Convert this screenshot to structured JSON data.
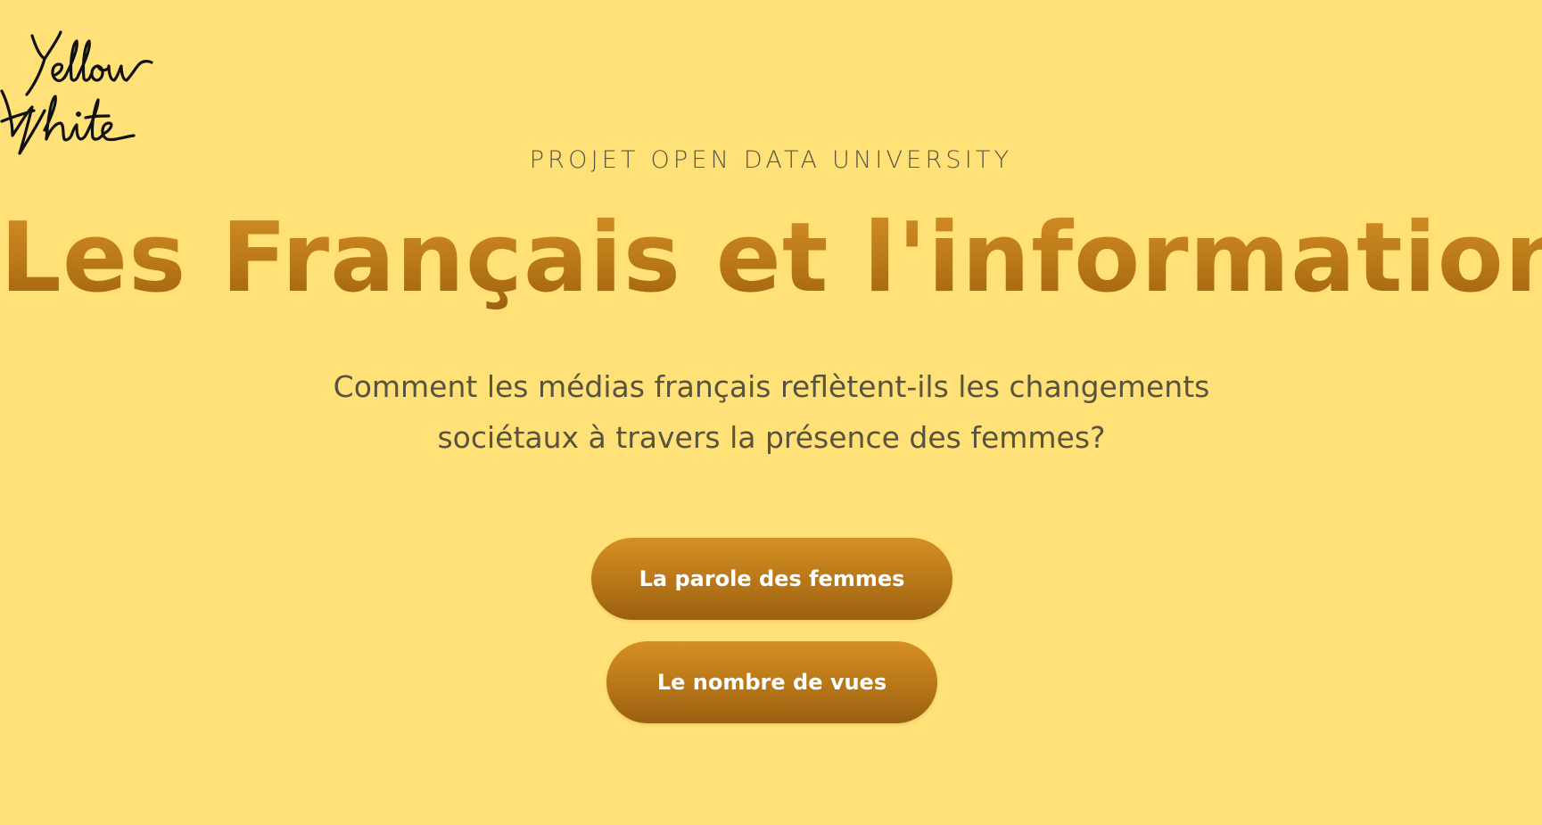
{
  "logo": {
    "text_line1": "Yellow",
    "text_line2": "White",
    "color": "#111111"
  },
  "hero": {
    "eyebrow": "PROJET OPEN DATA UNIVERSITY",
    "title": "Les Français et l'information",
    "subtitle": "Comment les médias français reflètent-ils les changements sociétaux à travers la présence des femmes?"
  },
  "buttons": {
    "primary_label": "La parole des femmes",
    "secondary_label": "Le nombre de vues"
  },
  "colors": {
    "background": "#ffe177",
    "accent_top": "#d58f24",
    "accent_bottom": "#9a5f11",
    "text_muted": "#57533f"
  }
}
